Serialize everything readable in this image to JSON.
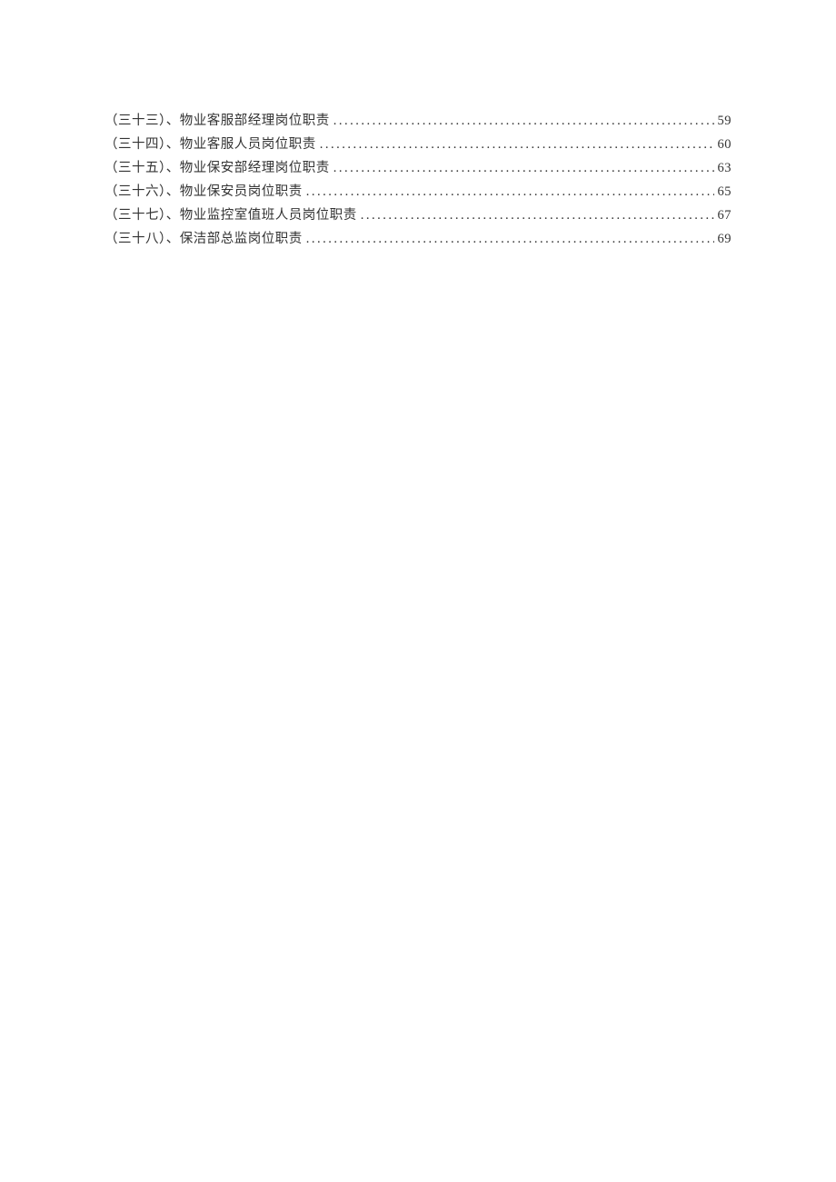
{
  "toc": {
    "entries": [
      {
        "number": "（三十三）、",
        "title": "物业客服部经理岗位职责",
        "page": "59"
      },
      {
        "number": "（三十四）、",
        "title": "物业客服人员岗位职责",
        "page": "60"
      },
      {
        "number": "（三十五）、",
        "title": "物业保安部经理岗位职责",
        "page": "63"
      },
      {
        "number": "（三十六）、",
        "title": "物业保安员岗位职责",
        "page": "65"
      },
      {
        "number": "（三十七）、",
        "title": "物业监控室值班人员岗位职责",
        "page": "67"
      },
      {
        "number": "（三十八）、",
        "title": "保洁部总监岗位职责",
        "page": "69"
      }
    ]
  }
}
